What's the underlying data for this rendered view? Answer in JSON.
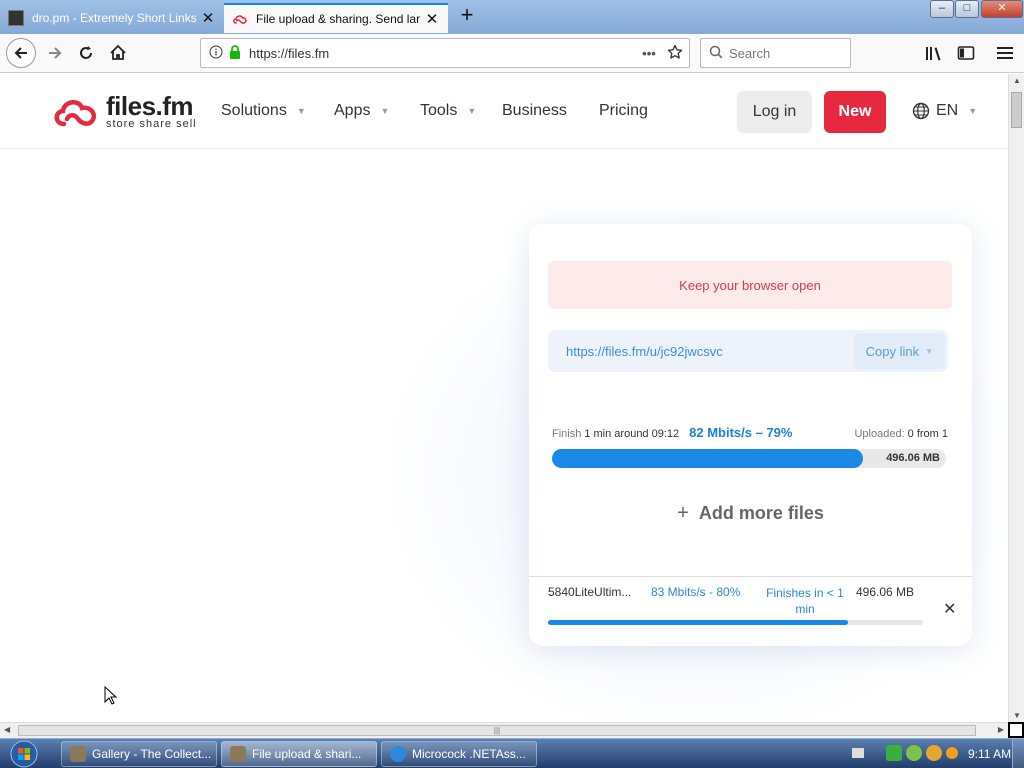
{
  "browser": {
    "tabs": [
      {
        "title": "dro.pm - Extremely Short Links",
        "active": false
      },
      {
        "title": "File upload & sharing. Send lar",
        "active": true
      }
    ],
    "url": "https://files.fm",
    "search_placeholder": "Search",
    "window_buttons": {
      "minimize": "–",
      "maximize": "□",
      "close": "✕"
    }
  },
  "site": {
    "logo": {
      "name": "files.fm",
      "tagline": "store share sell"
    },
    "nav": [
      {
        "label": "Solutions",
        "has_dropdown": true
      },
      {
        "label": "Apps",
        "has_dropdown": true
      },
      {
        "label": "Tools",
        "has_dropdown": true
      },
      {
        "label": "Business",
        "has_dropdown": false
      },
      {
        "label": "Pricing",
        "has_dropdown": false
      }
    ],
    "login_label": "Log in",
    "new_label": "New",
    "language": "EN"
  },
  "upload": {
    "notice": "Keep your browser open",
    "share_url": "https://files.fm/u/jc92jwcsvc",
    "copy_link_label": "Copy link",
    "finish_label": "Finish",
    "finish_value": "1 min around 09:12",
    "speed": "82 Mbits/s – 79%",
    "progress_percent": 79,
    "uploaded_label": "Uploaded:",
    "uploaded_value": "0 from 1",
    "total_size": "496.06 MB",
    "add_more_label": "Add more files",
    "file": {
      "name": "5840LiteUltim...",
      "speed": "83 Mbits/s - 80%",
      "eta": "Finishes in < 1 min",
      "size": "496.06 MB",
      "progress_percent": 80
    }
  },
  "taskbar": {
    "tasks": [
      {
        "label": "Gallery - The Collect..."
      },
      {
        "label": "File upload & shari..."
      },
      {
        "label": "Microcock .NETAss..."
      }
    ],
    "clock": "9:11 AM"
  },
  "colors": {
    "brand_red": "#e6293e",
    "progress_blue": "#1a88e6",
    "link_blue": "#3b8ed8"
  }
}
